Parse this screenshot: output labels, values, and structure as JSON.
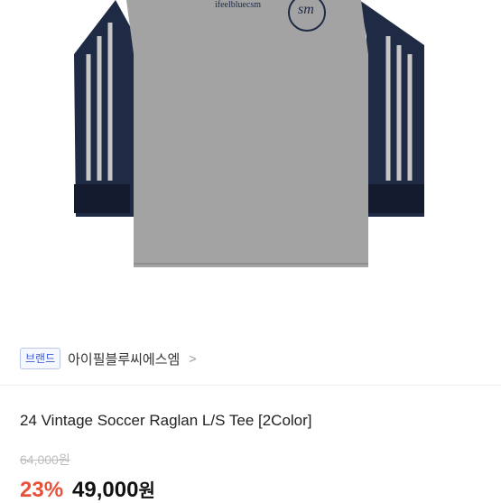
{
  "product": {
    "logo_text": "ifeelbluecsm",
    "emblem_text": "sm",
    "brand_badge": "브랜드",
    "brand_name": "아이필블루씨에스엠",
    "brand_chevron": ">",
    "title": "24 Vintage Soccer Raglan L/S Tee [2Color]",
    "original_price": "64,000원",
    "discount_rate": "23%",
    "sale_price": "49,000",
    "currency": "원"
  },
  "colors": {
    "body_gray": "#a3a3a3",
    "sleeve_navy": "#1f2a44",
    "discount_red": "#e8503a",
    "badge_blue": "#3a5bd0"
  }
}
